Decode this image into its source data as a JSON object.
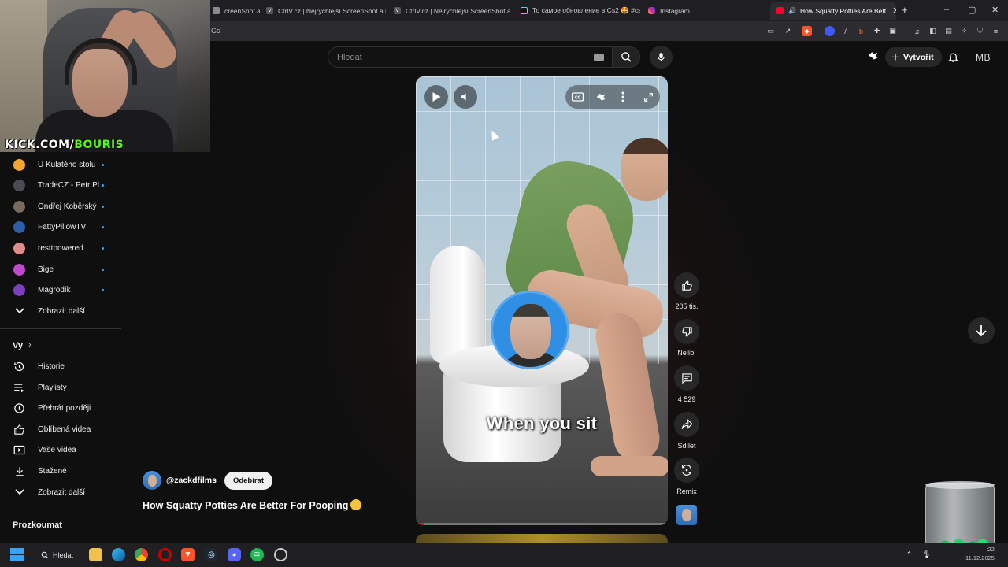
{
  "browser": {
    "tabs": [
      {
        "title": "creenShot a P",
        "color": "#8a8a8a"
      },
      {
        "title": "CtrlV.cz | Nejrychlejší ScreenShot a P",
        "color": "#6a6a6a"
      },
      {
        "title": "CtrlV.cz | Nejrychlejší ScreenShot a P",
        "color": "#6a6a6a"
      },
      {
        "title": "То самое обновление в Cs2 🤩 #cs",
        "color": "#111111"
      },
      {
        "title": "Instagram",
        "color": "#d6249f"
      },
      {
        "title": "How Squatty Potties Are Bett",
        "color": "#ff0033"
      }
    ],
    "new_tab": "+",
    "close_tab": "✕",
    "window_controls": [
      "–",
      "▢",
      "✕"
    ],
    "url_fragment": "Gs"
  },
  "webcam": {
    "overlay_prefix": "KICK.COM/",
    "overlay_name": "BOURIS"
  },
  "header": {
    "search_placeholder": "Hledat",
    "create_label": "Vytvořit",
    "account_initials": "MB"
  },
  "sidebar": {
    "subscriptions": [
      {
        "label": "U Kulatého stolu",
        "avatar_color": "#f2a531"
      },
      {
        "label": "TradeCZ - Petr Pl...",
        "avatar_color": "#4b4b55"
      },
      {
        "label": "Ondřej Koběrský",
        "avatar_color": "#7a6a5c"
      },
      {
        "label": "FattyPillowTV",
        "avatar_color": "#2c5fa8"
      },
      {
        "label": "resttpowered",
        "avatar_color": "#e08a8a"
      },
      {
        "label": "Bige",
        "avatar_color": "#c04ad0"
      },
      {
        "label": "Magrodík",
        "avatar_color": "#7b3fc2"
      }
    ],
    "show_more_1": "Zobrazit další",
    "you_section": "Vy",
    "you_items": [
      {
        "label": "Historie",
        "icon": "history-icon"
      },
      {
        "label": "Playlisty",
        "icon": "playlist-icon"
      },
      {
        "label": "Přehrát později",
        "icon": "clock-icon"
      },
      {
        "label": "Oblíbená videa",
        "icon": "thumb-up-icon"
      },
      {
        "label": "Vaše videa",
        "icon": "your-videos-icon"
      },
      {
        "label": "Stažené",
        "icon": "download-icon"
      }
    ],
    "show_more_2": "Zobrazit další",
    "explore_section": "Prozkoumat"
  },
  "short": {
    "caption": "When you sit",
    "channel_handle": "@zackdfilms",
    "subscribe_label": "Odebírat",
    "title": "How Squatty Potties Are Better For Pooping",
    "progress": 0.03
  },
  "actions": {
    "likes": "205 tis.",
    "dislike": "Nelíbí",
    "comments": "4 529",
    "share": "Sdílet",
    "remix": "Remix"
  },
  "taskbar": {
    "search_label": "Hledat",
    "time": ":22",
    "date": "11.12.2025"
  }
}
